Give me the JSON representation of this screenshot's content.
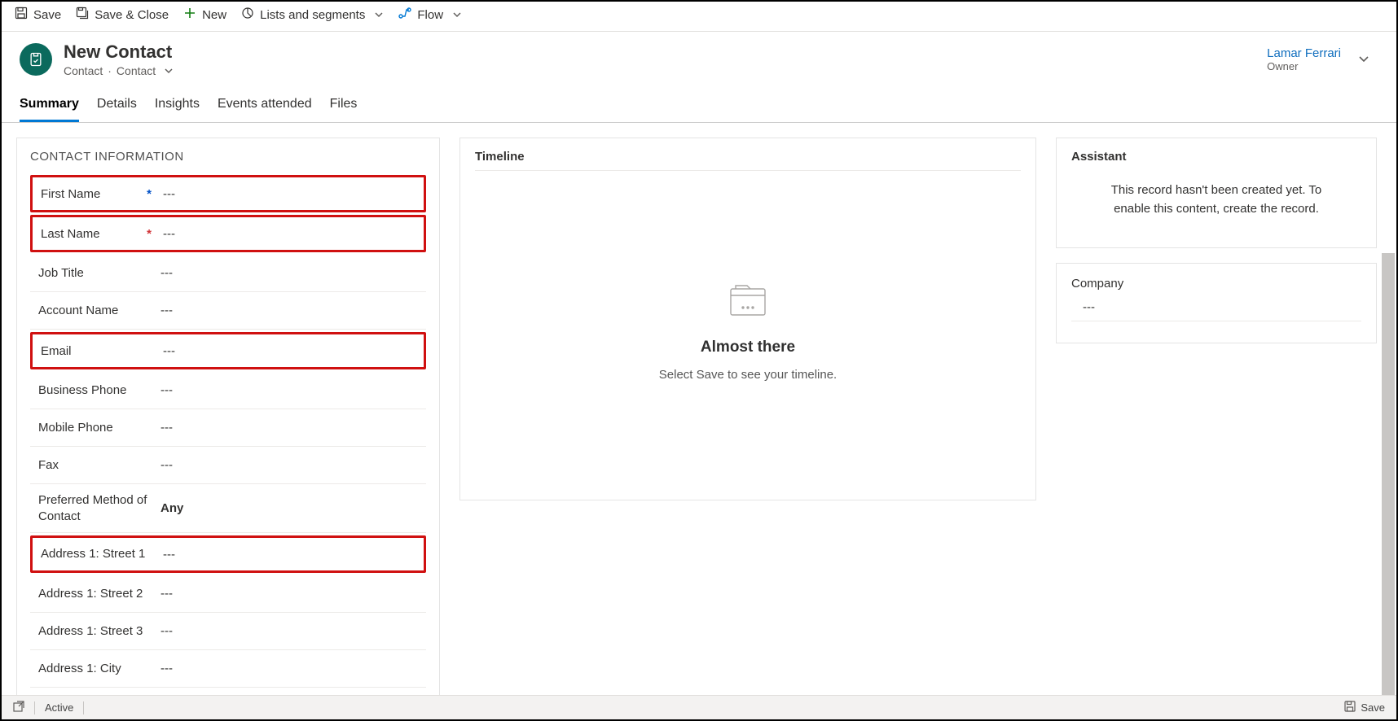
{
  "commands": {
    "save": "Save",
    "save_close": "Save & Close",
    "new": "New",
    "lists": "Lists and segments",
    "flow": "Flow"
  },
  "header": {
    "title": "New Contact",
    "entity": "Contact",
    "form": "Contact",
    "owner_name": "Lamar Ferrari",
    "owner_label": "Owner"
  },
  "tabs": [
    "Summary",
    "Details",
    "Insights",
    "Events attended",
    "Files"
  ],
  "active_tab": "Summary",
  "contact_section": {
    "title": "CONTACT INFORMATION",
    "fields": [
      {
        "label": "First Name",
        "value": "---",
        "required": "blue",
        "highlight": true
      },
      {
        "label": "Last Name",
        "value": "---",
        "required": "red",
        "highlight": true
      },
      {
        "label": "Job Title",
        "value": "---"
      },
      {
        "label": "Account Name",
        "value": "---"
      },
      {
        "label": "Email",
        "value": "---",
        "highlight": true
      },
      {
        "label": "Business Phone",
        "value": "---"
      },
      {
        "label": "Mobile Phone",
        "value": "---"
      },
      {
        "label": "Fax",
        "value": "---"
      },
      {
        "label": "Preferred Method of Contact",
        "value": "Any",
        "bold": true
      },
      {
        "label": "Address 1: Street 1",
        "value": "---",
        "highlight": true
      },
      {
        "label": "Address 1: Street 2",
        "value": "---"
      },
      {
        "label": "Address 1: Street 3",
        "value": "---"
      },
      {
        "label": "Address 1: City",
        "value": "---"
      }
    ]
  },
  "timeline": {
    "title": "Timeline",
    "heading": "Almost there",
    "sub": "Select Save to see your timeline."
  },
  "assistant": {
    "title": "Assistant",
    "msg": "This record hasn't been created yet. To enable this content, create the record."
  },
  "company": {
    "label": "Company",
    "value": "---"
  },
  "statusbar": {
    "status": "Active",
    "save": "Save"
  }
}
